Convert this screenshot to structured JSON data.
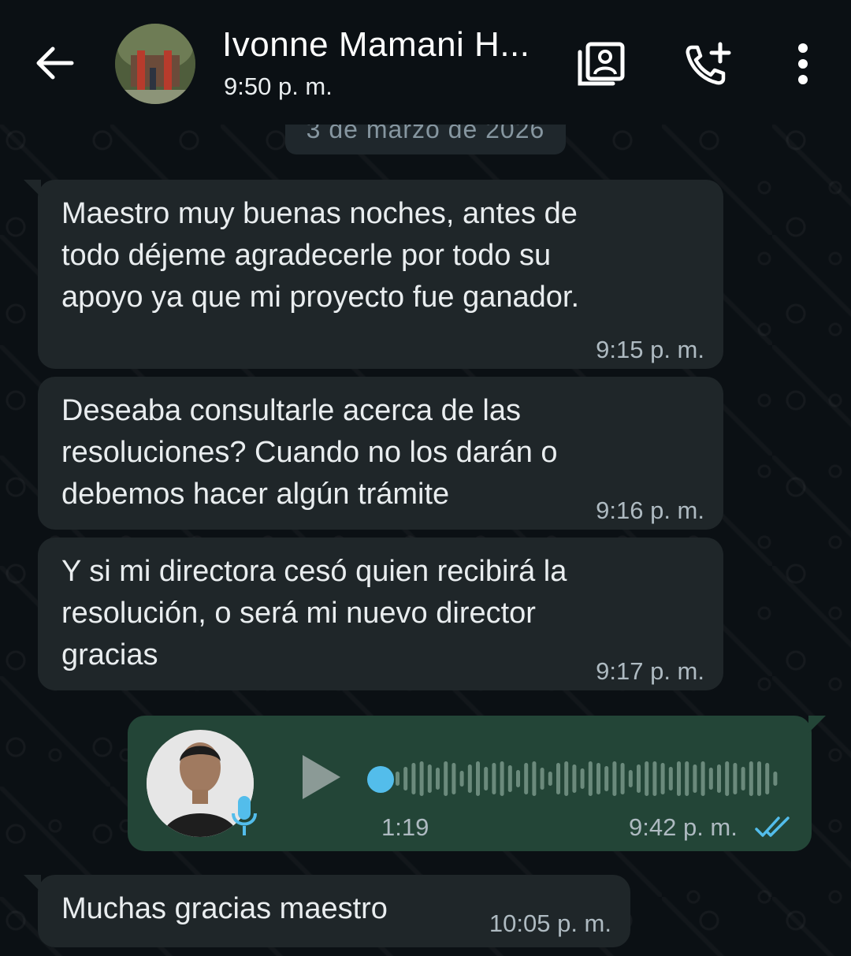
{
  "header": {
    "contact_name": "Ivonne Mamani H...",
    "last_seen": "9:50 p. m.",
    "icons": [
      "back-arrow-icon",
      "contact-card-icon",
      "add-call-icon",
      "more-vert-icon"
    ]
  },
  "date_separator": "3 de marzo de 2026",
  "messages": [
    {
      "direction": "incoming",
      "text": "Maestro muy buenas noches, antes de\ntodo déjeme agradecerle por todo su\napoyo ya que mi proyecto fue ganador.",
      "time": "9:15 p. m."
    },
    {
      "direction": "incoming",
      "text": "Deseaba consultarle acerca de las\nresoluciones? Cuando no los darán o\ndebemos hacer algún trámite",
      "time": "9:16 p. m."
    },
    {
      "direction": "incoming",
      "text": "Y si mi directora cesó quien recibirá la\nresolución, o será mi nuevo director\ngracias",
      "time": "9:17 p. m."
    },
    {
      "direction": "outgoing",
      "type": "voice",
      "duration": "1:19",
      "time": "9:42 p. m.",
      "status": "read"
    },
    {
      "direction": "incoming",
      "text": "Muchas gracias maestro",
      "time": "10:05 p. m."
    }
  ],
  "colors": {
    "background": "#0b1014",
    "incoming_bubble": "#1f2629",
    "outgoing_bubble": "#234537",
    "read_ticks": "#53bdeb",
    "seek_dot": "#53bdeb",
    "secondary_text": "#aebac1"
  }
}
